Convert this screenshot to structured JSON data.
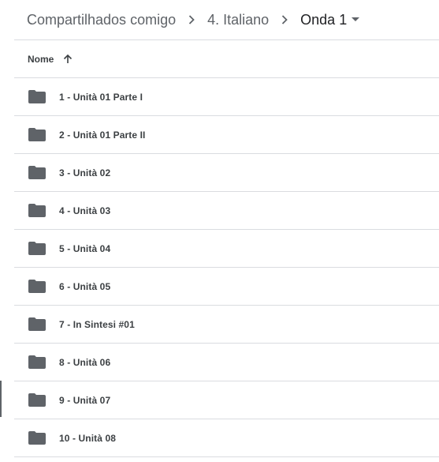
{
  "breadcrumb": {
    "items": [
      "Compartilhados comigo",
      "4. Italiano"
    ],
    "current": "Onda 1"
  },
  "icons": {
    "separator": "chevron-right-icon",
    "dropdown": "caret-down-icon",
    "sort": "arrow-up-icon",
    "folder": "folder-icon"
  },
  "columns": {
    "name_label": "Nome",
    "sort_direction": "ascending"
  },
  "files": [
    {
      "name": "1 - Unità 01 Parte I"
    },
    {
      "name": "2 - Unità 01 Parte II"
    },
    {
      "name": "3 - Unità 02"
    },
    {
      "name": "4 - Unità 03"
    },
    {
      "name": "5 - Unità 04"
    },
    {
      "name": "6 - Unità 05"
    },
    {
      "name": "7 - In Sintesi #01"
    },
    {
      "name": "8 - Unità 06"
    },
    {
      "name": "9 - Unità 07"
    },
    {
      "name": "10 - Unità 08"
    }
  ],
  "colors": {
    "text": "#3c4043",
    "muted": "#5f6368",
    "folder": "#5f6368",
    "divider": "#dadce0"
  }
}
